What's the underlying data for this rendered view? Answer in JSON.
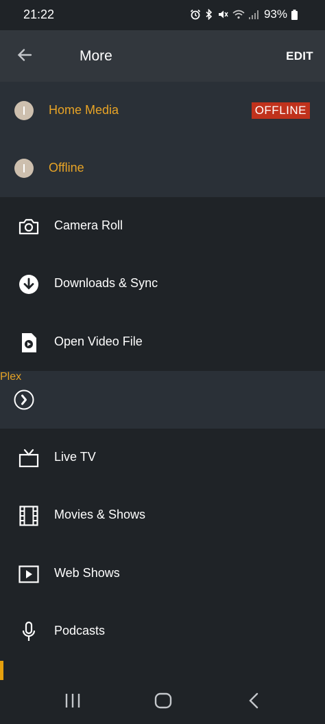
{
  "status_bar": {
    "time": "21:22",
    "battery": "93%"
  },
  "header": {
    "title": "More",
    "edit_label": "EDIT"
  },
  "servers": [
    {
      "name": "Home Media",
      "badge": "OFFLINE"
    },
    {
      "name": "Offline"
    }
  ],
  "menu_top": [
    {
      "label": "Camera Roll",
      "icon": "camera-icon"
    },
    {
      "label": "Downloads & Sync",
      "icon": "download-icon"
    },
    {
      "label": "Open Video File",
      "icon": "video-file-icon"
    }
  ],
  "plex": {
    "label": "Plex",
    "icon": "plex-chevron-icon"
  },
  "menu_bottom": [
    {
      "label": "Live TV",
      "icon": "tv-icon"
    },
    {
      "label": "Movies & Shows",
      "icon": "film-icon"
    },
    {
      "label": "Web Shows",
      "icon": "play-box-icon"
    },
    {
      "label": "Podcasts",
      "icon": "microphone-icon"
    }
  ],
  "colors": {
    "accent": "#e8a426",
    "badge": "#c0321c",
    "background": "#1f2327",
    "section": "#2a3037",
    "app_bar": "#32373d"
  }
}
